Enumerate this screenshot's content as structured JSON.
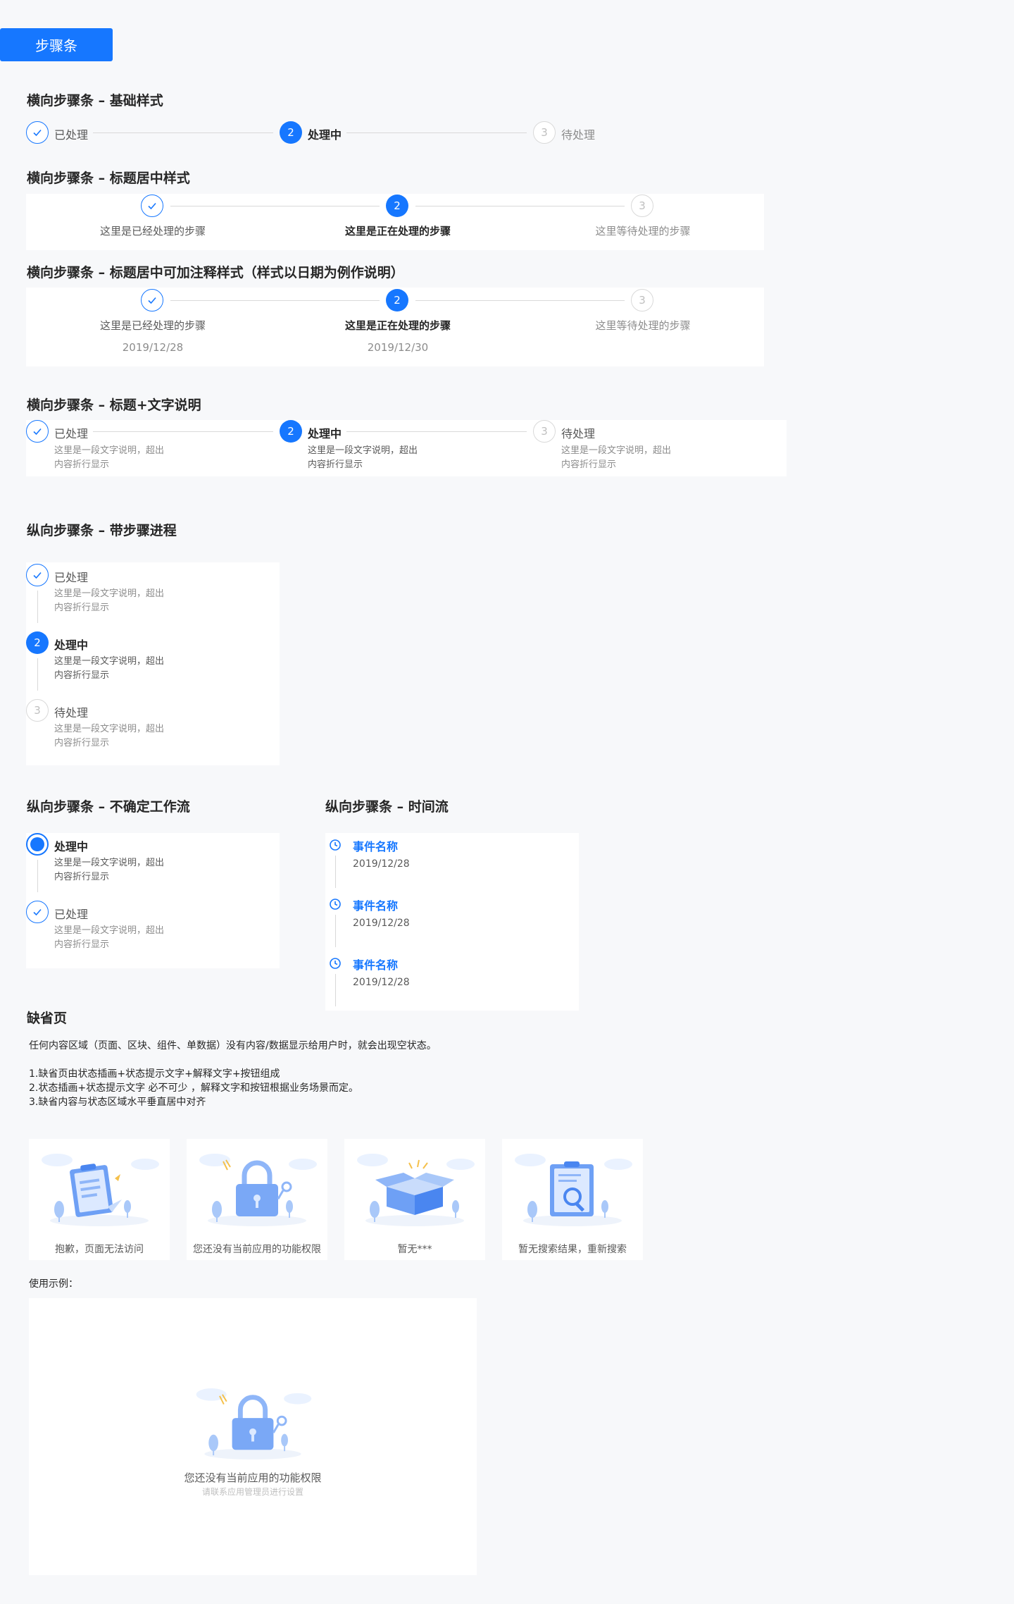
{
  "header": {
    "badge": "步骤条"
  },
  "sections": {
    "s1": "横向步骤条 – 基础样式",
    "s2": "横向步骤条 – 标题居中样式",
    "s3": "横向步骤条 – 标题居中可加注释样式（样式以日期为例作说明）",
    "s4": "横向步骤条 – 标题+文字说明",
    "s5": "纵向步骤条 – 带步骤进程",
    "s6": "纵向步骤条 – 不确定工作流",
    "s7": "纵向步骤条 – 时间流",
    "s8": "缺省页"
  },
  "steps": {
    "done": "已处理",
    "current": "处理中",
    "wait": "待处理",
    "num2": "2",
    "num3": "3",
    "center_done": "这里是已经处理的步骤",
    "center_cur": "这里是正在处理的步骤",
    "center_wait": "这里等待处理的步骤",
    "date1": "2019/12/28",
    "date2": "2019/12/30",
    "desc_l1": "这里是一段文字说明，超出",
    "desc_l2": "内容折行显示"
  },
  "timeline": {
    "event": "事件名称",
    "date": "2019/12/28"
  },
  "empty": {
    "intro": "任何内容区域（页面、区块、组件、单数据）没有内容/数据显示给用户时，就会出现空状态。",
    "rule1": "1.缺省页由状态插画+状态提示文字+解释文字+按钮组成",
    "rule2": "2.状态插画+状态提示文字 必不可少 ，解释文字和按钮根据业务场景而定。",
    "rule3": "3.缺省内容与状态区域水平垂直居中对齐",
    "cards": [
      {
        "caption": "抱歉，页面无法访问",
        "icon": "clipboard-icon"
      },
      {
        "caption": "您还没有当前应用的功能权限",
        "icon": "lock-icon"
      },
      {
        "caption": "暂无***",
        "icon": "box-icon"
      },
      {
        "caption": "暂无搜索结果，重新搜索",
        "icon": "search-document-icon"
      }
    ],
    "example_label": "使用示例：",
    "example_title": "您还没有当前应用的功能权限",
    "example_sub": "请联系应用管理员进行设置"
  },
  "colors": {
    "primary": "#1677ff",
    "border": "#d9d9d9",
    "muted": "#8c8c8c",
    "bg": "#f7f8fa"
  }
}
